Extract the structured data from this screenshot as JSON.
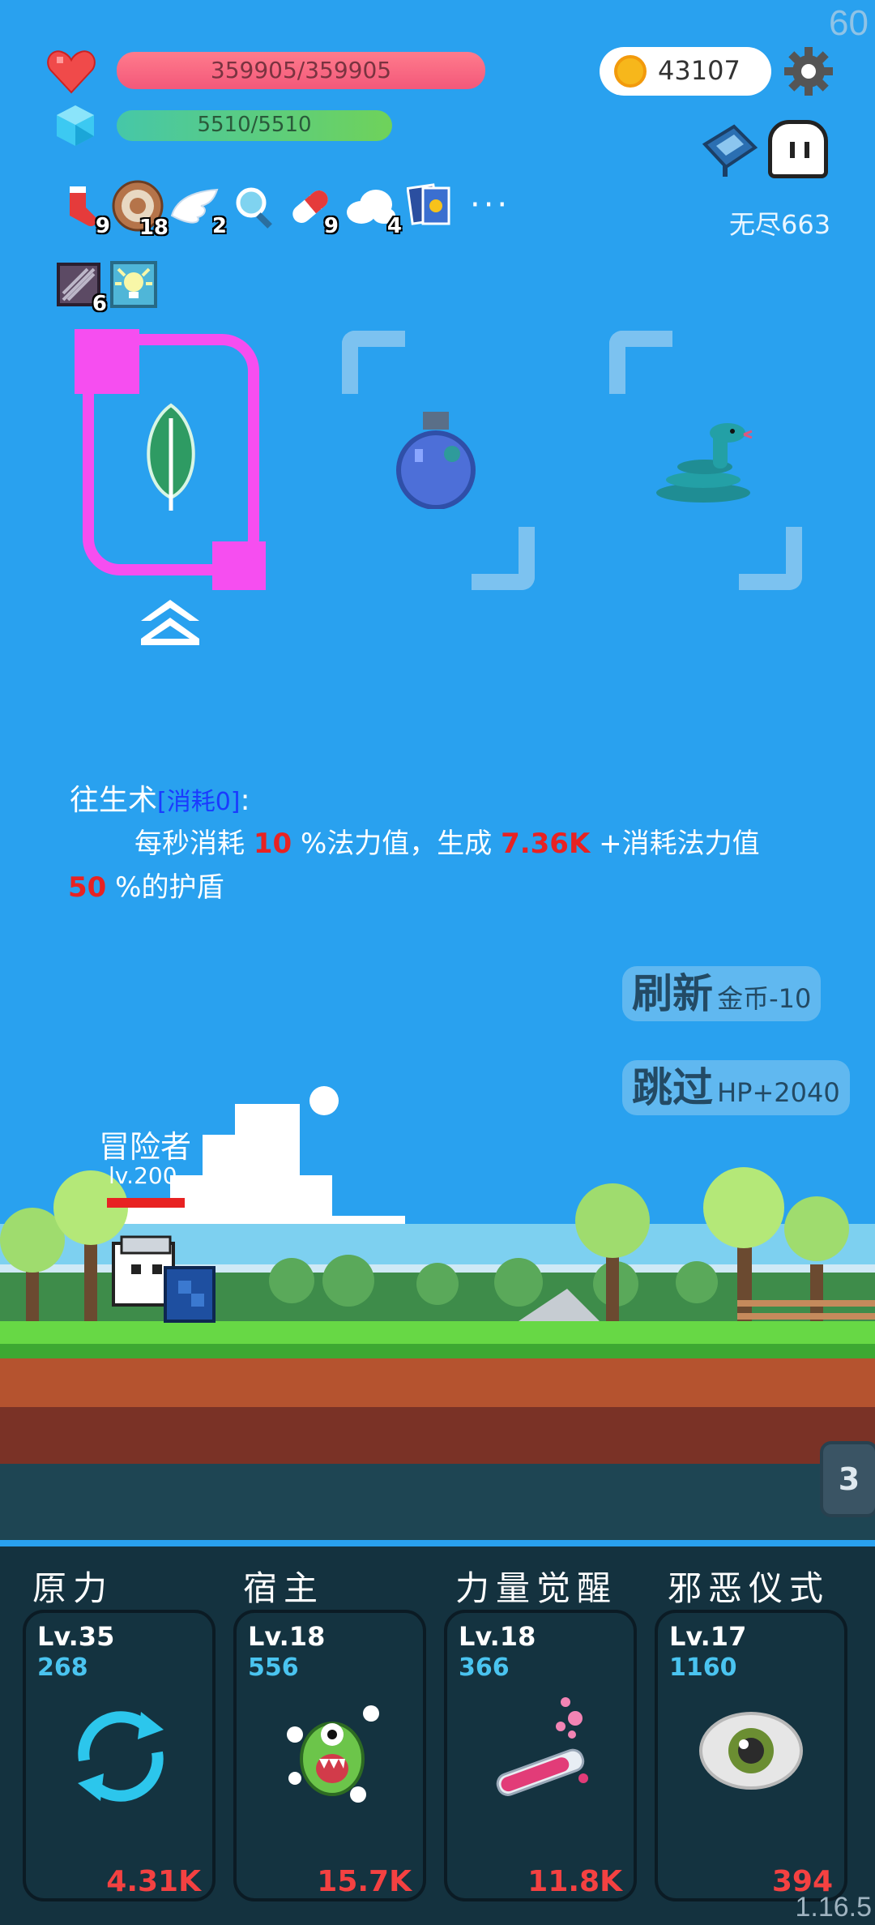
{
  "fps": "60",
  "version": "1.16.5",
  "hp": "359905/359905",
  "mp": "5510/5510",
  "coins": "43107",
  "endless": "无尽663",
  "items": [
    {
      "icon": "sock-icon",
      "count": "9"
    },
    {
      "icon": "target-icon",
      "count": "18"
    },
    {
      "icon": "wing-icon",
      "count": "2"
    },
    {
      "icon": "magnifier-icon",
      "count": ""
    },
    {
      "icon": "pill-icon",
      "count": "9"
    },
    {
      "icon": "cloud-icon",
      "count": "4"
    },
    {
      "icon": "cards-icon",
      "count": ""
    }
  ],
  "more": "···",
  "items2": [
    {
      "icon": "box-icon",
      "count": "6"
    },
    {
      "icon": "lamp-icon",
      "count": ""
    }
  ],
  "spell": {
    "name": "往生术",
    "cost": "[消耗0]",
    "colon": ":",
    "line1_a": "每秒消耗 ",
    "line1_b": "10",
    "line1_c": " %法力值，生成 ",
    "line1_d": "7.36K",
    "line1_e": " +消耗法力值",
    "line2_a": "50",
    "line2_b": " %的护盾"
  },
  "refresh": {
    "label": "刷新",
    "cost": "金币-10"
  },
  "skip": {
    "label": "跳过",
    "bonus": "HP+2040"
  },
  "hero": {
    "name": "冒险者",
    "level": "lv.200"
  },
  "page_tab": "3",
  "skills": [
    {
      "title": "原力",
      "level": "Lv.35",
      "cost": "268",
      "value": "4.31K",
      "icon": "refresh-icon"
    },
    {
      "title": "宿主",
      "level": "Lv.18",
      "cost": "556",
      "value": "15.7K",
      "icon": "monster-icon"
    },
    {
      "title": "力量觉醒",
      "level": "Lv.18",
      "cost": "366",
      "value": "11.8K",
      "icon": "potion-tube-icon"
    },
    {
      "title": "邪恶仪式",
      "level": "Lv.17",
      "cost": "1160",
      "value": "394",
      "icon": "eye-icon"
    }
  ],
  "colors": {
    "sky": "#29a1ef",
    "select": "#f64ef0",
    "red_text": "#e82222"
  }
}
